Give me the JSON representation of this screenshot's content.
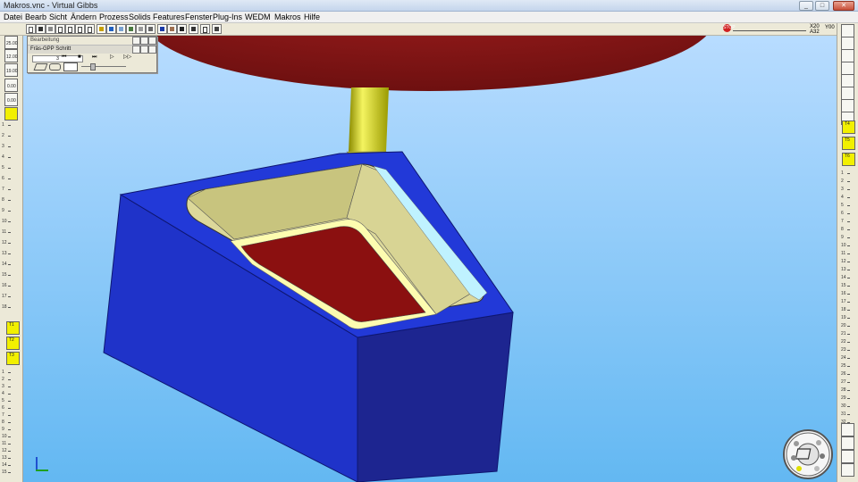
{
  "window": {
    "title": "Makros.vnc - Virtual Gibbs",
    "controls": [
      "_",
      "□",
      "✕"
    ]
  },
  "menubar": {
    "items": [
      "Datei",
      "Bearb",
      "Sicht",
      "Ändern",
      "Prozess",
      "Solids",
      "Features",
      "Fenster",
      "Plug-Ins",
      "WEDM",
      "Makros",
      "Hilfe"
    ]
  },
  "toolbar": {
    "icons": [
      "new-icon",
      "open-icon",
      "save-icon",
      "undo-icon",
      "cut-icon",
      "copy-icon",
      "paste-icon",
      "print-icon",
      "shade-icon",
      "zoom-icon",
      "rotate-icon",
      "settings-icon",
      "help-icon"
    ],
    "stop_label": "STOP",
    "readout_top": "X20",
    "readout_bottom": "A32",
    "readout_right": "Y00"
  },
  "palette": {
    "title": "Bearbeitung",
    "subtitle": "Fräs-GPP Schritt",
    "step_value": "3",
    "controls": [
      "⏮",
      "■",
      "⏭",
      "▷",
      "▷▷"
    ]
  },
  "left_panel": {
    "labels": [
      "25.00",
      "12.00",
      "19.00",
      "0.00",
      "0.00"
    ],
    "ruler_top": [
      "1",
      "2",
      "3",
      "4",
      "5",
      "6",
      "7",
      "8",
      "9",
      "10",
      "11",
      "12",
      "13",
      "14",
      "15",
      "16",
      "17",
      "18"
    ],
    "ruler_bottom": [
      "1",
      "2",
      "3",
      "4",
      "5",
      "6",
      "7",
      "8",
      "9",
      "10",
      "11",
      "12",
      "13",
      "14",
      "15"
    ],
    "tool_labels": [
      "T1",
      "T2",
      "T3"
    ]
  },
  "right_panel": {
    "tool_labels": [
      "T4",
      "T5",
      "T6"
    ],
    "ruler": [
      "1",
      "2",
      "3",
      "4",
      "5",
      "6",
      "7",
      "8",
      "9",
      "10",
      "11",
      "12",
      "13",
      "14",
      "15",
      "16",
      "17",
      "18",
      "19",
      "20",
      "21",
      "22",
      "23",
      "24",
      "25",
      "26",
      "27",
      "28",
      "29",
      "30",
      "31",
      "32"
    ]
  },
  "colors": {
    "background_top": "#b8dcff",
    "background_bottom": "#63b8f2",
    "part_blue": "#1f33c9",
    "part_dark_blue": "#1d2590",
    "pocket_floor": "#8b1010",
    "pocket_wall": "#d4d08a",
    "tool_yellow": "#e0e000",
    "spindle_red": "#8a1616"
  }
}
